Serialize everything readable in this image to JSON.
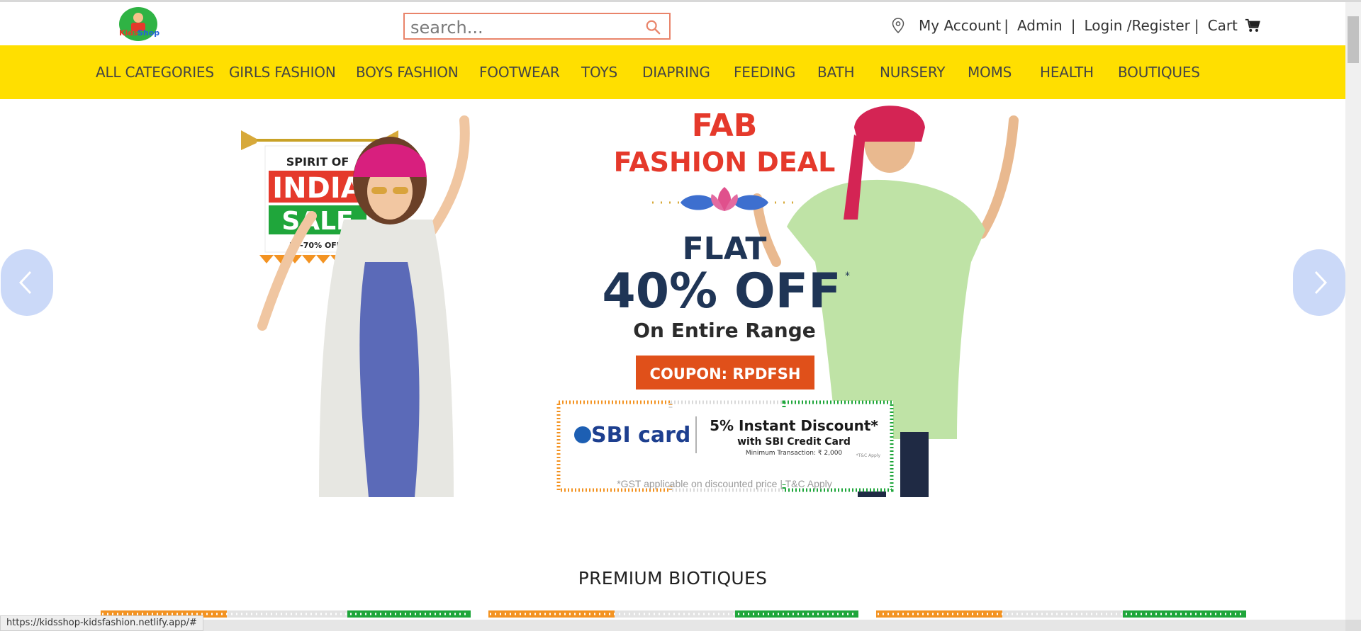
{
  "header": {
    "logo_text": "Kids Shop",
    "search_placeholder": "search...",
    "links": {
      "my_account": "My Account",
      "admin": "Admin",
      "login": "Login /Register",
      "cart": "Cart",
      "separator": "|"
    }
  },
  "nav": {
    "items": [
      "ALL CATEGORIES",
      "GIRLS FASHION",
      "BOYS FASHION",
      "FOOTWEAR",
      "TOYS",
      "DIAPRING",
      "FEEDING",
      "BATH",
      "NURSERY",
      "MOMS",
      "HEALTH",
      "BOUTIQUES"
    ]
  },
  "banner": {
    "badge_line1": "SPIRIT OF",
    "badge_line2": "INDIA",
    "badge_line3": "SALE",
    "badge_line4": "30-70% OFF*",
    "title_line1": "FAB",
    "title_line2": "FASHION DEAL",
    "flat": "FLAT",
    "discount": "40% OFF",
    "discount_star": "*",
    "range": "On Entire Range",
    "coupon": "COUPON: RPDFSH",
    "sbi_brand": "SBI card",
    "sbi_offer": "5% Instant Discount*",
    "sbi_sub": "with SBI Credit Card",
    "sbi_min": "Minimum Transaction: ₹ 2,000",
    "sbi_tc": "*T&C Apply",
    "footnote": "*GST applicable on discounted price | T&C Apply",
    "colors": {
      "title_red": "#e5392b",
      "navy": "#1f3556",
      "coupon_bg": "#e0501a",
      "saffron": "#f39322",
      "green": "#1fa63b"
    }
  },
  "section": {
    "premium_title": "PREMIUM BIOTIQUES"
  },
  "status": {
    "url": "https://kidsshop-kidsfashion.netlify.app/#"
  },
  "colors": {
    "nav_bg": "#ffdf00",
    "search_border": "#e9846a",
    "arrow_bg": "#c9d7f8"
  }
}
